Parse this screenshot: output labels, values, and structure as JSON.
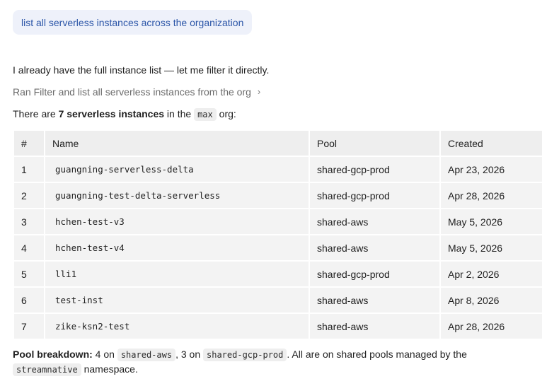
{
  "user_message": "list all serverless instances across the organization",
  "assistant": {
    "intro": "I already have the full instance list — let me filter it directly.",
    "tool_call_label": "Ran Filter and list all serverless instances from the org",
    "tool_chevron": "›",
    "summary": {
      "prefix": "There are ",
      "count_text": "7 serverless instances",
      "middle": " in the ",
      "org": "max",
      "suffix": " org:"
    },
    "table": {
      "headers": [
        "#",
        "Name",
        "Pool",
        "Created"
      ],
      "rows": [
        {
          "num": "1",
          "name": "guangning-serverless-delta",
          "pool": "shared-gcp-prod",
          "created": "Apr 23, 2026"
        },
        {
          "num": "2",
          "name": "guangning-test-delta-serverless",
          "pool": "shared-gcp-prod",
          "created": "Apr 28, 2026"
        },
        {
          "num": "3",
          "name": "hchen-test-v3",
          "pool": "shared-aws",
          "created": "May 5, 2026"
        },
        {
          "num": "4",
          "name": "hchen-test-v4",
          "pool": "shared-aws",
          "created": "May 5, 2026"
        },
        {
          "num": "5",
          "name": "lli1",
          "pool": "shared-gcp-prod",
          "created": "Apr 2, 2026"
        },
        {
          "num": "6",
          "name": "test-inst",
          "pool": "shared-aws",
          "created": "Apr 8, 2026"
        },
        {
          "num": "7",
          "name": "zike-ksn2-test",
          "pool": "shared-aws",
          "created": "Apr 28, 2026"
        }
      ]
    },
    "breakdown": {
      "label": "Pool breakdown:",
      "t1": " 4 on ",
      "pool_a": "shared-aws",
      "t2": ", 3 on ",
      "pool_b": "shared-gcp-prod",
      "t3": ". All are on shared pools managed by the ",
      "namespace": "streamnative",
      "t4": " namespace."
    }
  },
  "colors": {
    "user_bubble_bg": "#eef1fa",
    "user_text": "#2c56a8",
    "table_header_bg": "#eeeeee",
    "table_cell_bg": "#f3f3f3"
  }
}
